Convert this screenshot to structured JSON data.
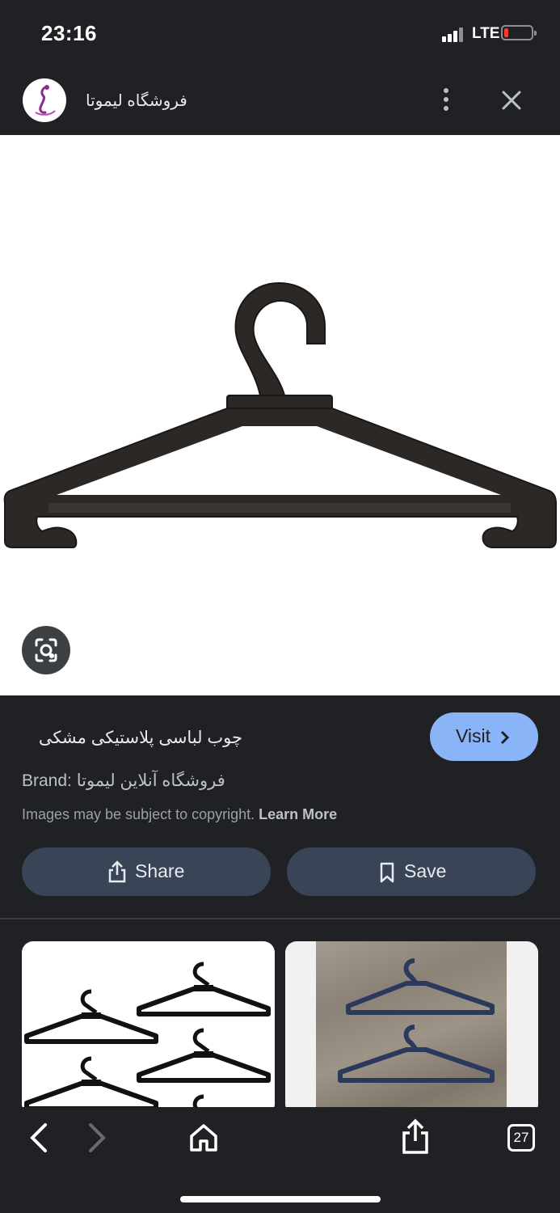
{
  "status_bar": {
    "time": "23:16",
    "network": "LTE"
  },
  "header": {
    "site_name": "فروشگاه لیموتا"
  },
  "result": {
    "title": "چوب لباسی پلاستیکی مشکی",
    "visit_label": "Visit",
    "brand": "Brand: فروشگاه آنلاین لیموتا",
    "copyright_text": "Images may be subject to copyright.",
    "learn_more": "Learn More",
    "share_label": "Share",
    "save_label": "Save"
  },
  "bottom_bar": {
    "tab_count": "27"
  },
  "colors": {
    "background": "#202124",
    "accent": "#8ab4f8",
    "button": "#394457"
  }
}
